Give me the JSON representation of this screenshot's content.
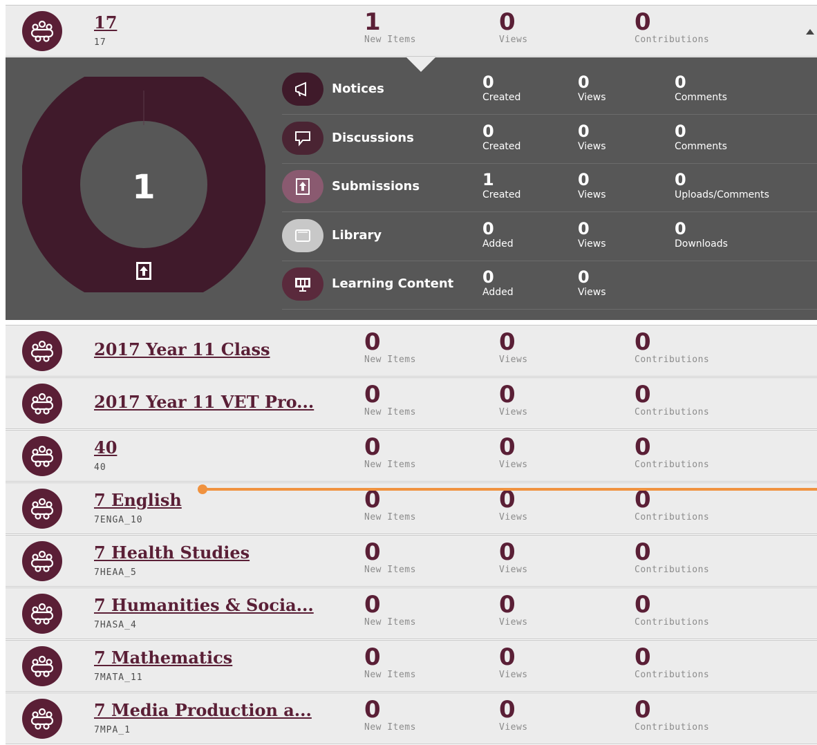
{
  "colors": {
    "brand": "#5a1f36",
    "panel": "#575757",
    "row_bg": "#ececec",
    "annotation": "#f0923f"
  },
  "stat_labels": {
    "new_items": "New Items",
    "views": "Views",
    "contributions": "Contributions"
  },
  "expanded_row": {
    "title": "17",
    "subtitle": "17",
    "new_items": "1",
    "views": "0",
    "contributions": "0",
    "icon": "class-group-icon",
    "caret_icon": "caret-up-icon"
  },
  "panel": {
    "donut_total": "1",
    "donut_center_icon": "submission-icon",
    "rows": [
      {
        "label": "Notices",
        "icon": "megaphone-icon",
        "icon_bg": "#3f1a2a",
        "c1": "0",
        "l1": "Created",
        "c2": "0",
        "l2": "Views",
        "c3": "0",
        "l3": "Comments"
      },
      {
        "label": "Discussions",
        "icon": "speech-bubble-icon",
        "icon_bg": "#4a2433",
        "c1": "0",
        "l1": "Created",
        "c2": "0",
        "l2": "Views",
        "c3": "0",
        "l3": "Comments"
      },
      {
        "label": "Submissions",
        "icon": "upload-document-icon",
        "icon_bg": "#8a5a70",
        "c1": "1",
        "l1": "Created",
        "c2": "0",
        "l2": "Views",
        "c3": "0",
        "l3": "Uploads/Comments"
      },
      {
        "label": "Library",
        "icon": "folder-icon",
        "icon_bg": "#c8c8c8",
        "c1": "0",
        "l1": "Added",
        "c2": "0",
        "l2": "Views",
        "c3": "0",
        "l3": "Downloads"
      },
      {
        "label": "Learning Content",
        "icon": "presentation-screen-icon",
        "icon_bg": "#5a2a3c",
        "c1": "0",
        "l1": "Added",
        "c2": "0",
        "l2": "Views",
        "c3": "",
        "l3": ""
      }
    ]
  },
  "classes": [
    {
      "title": "2017 Year 11 Class",
      "subtitle": "",
      "new_items": "0",
      "views": "0",
      "contributions": "0"
    },
    {
      "title": "2017 Year 11 VET Pro...",
      "subtitle": "",
      "new_items": "0",
      "views": "0",
      "contributions": "0"
    },
    {
      "title": "40",
      "subtitle": "40",
      "new_items": "0",
      "views": "0",
      "contributions": "0"
    },
    {
      "title": "7 English",
      "subtitle": "7ENGA_10",
      "new_items": "0",
      "views": "0",
      "contributions": "0"
    },
    {
      "title": "7 Health Studies",
      "subtitle": "7HEAA_5",
      "new_items": "0",
      "views": "0",
      "contributions": "0"
    },
    {
      "title": "7 Humanities & Socia...",
      "subtitle": "7HASA_4",
      "new_items": "0",
      "views": "0",
      "contributions": "0"
    },
    {
      "title": "7 Mathematics",
      "subtitle": "7MATA_11",
      "new_items": "0",
      "views": "0",
      "contributions": "0"
    },
    {
      "title": "7 Media Production a...",
      "subtitle": "7MPA_1",
      "new_items": "0",
      "views": "0",
      "contributions": "0"
    }
  ]
}
